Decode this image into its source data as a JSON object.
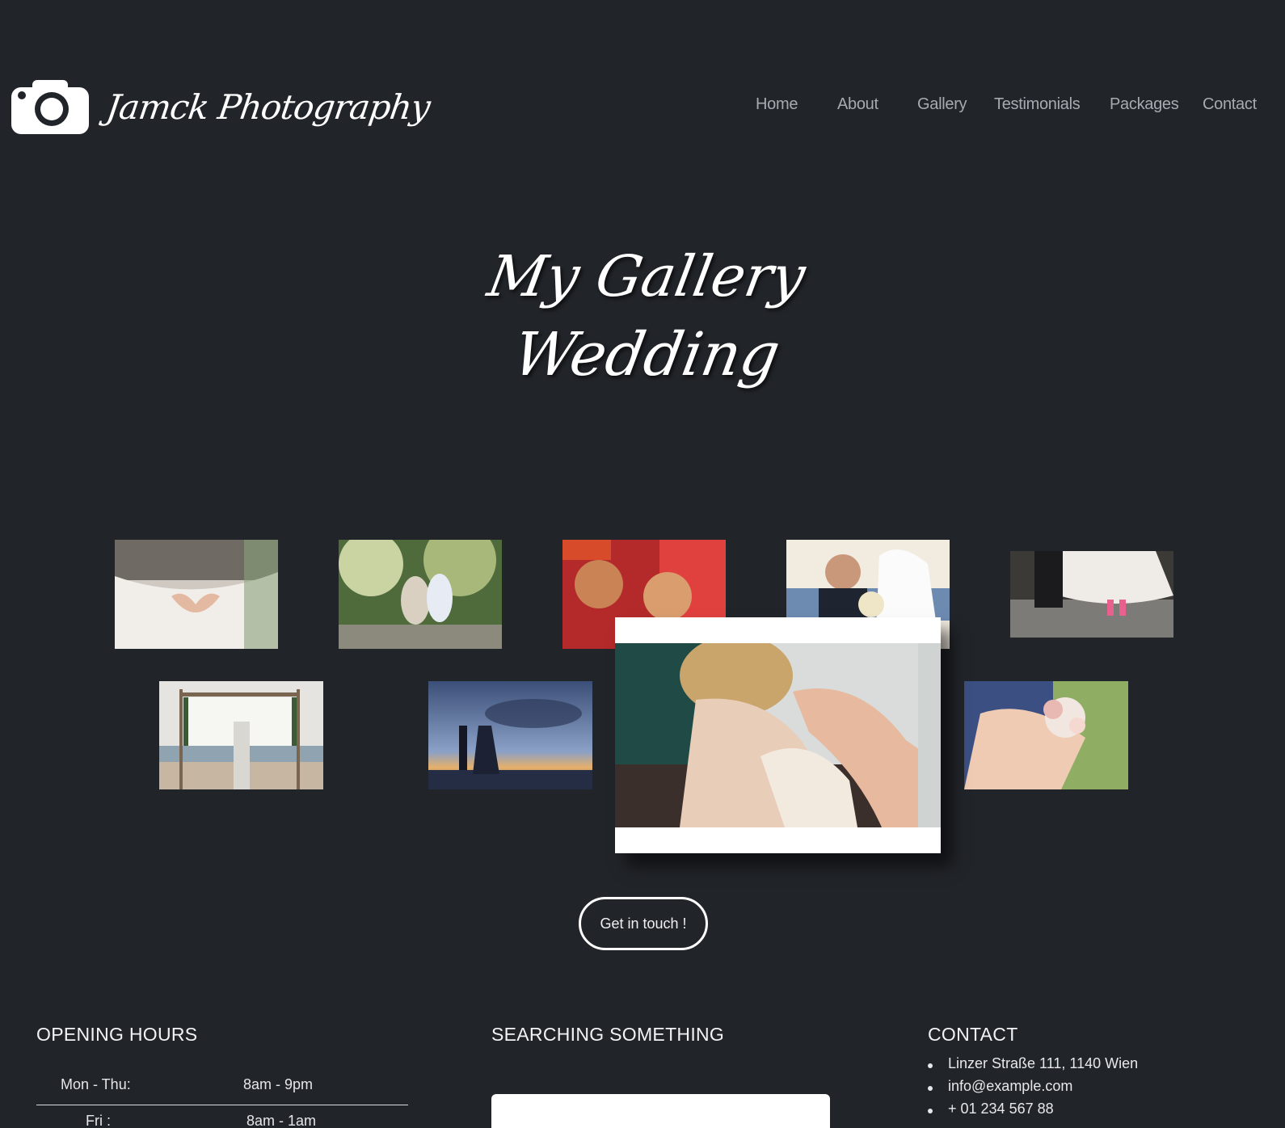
{
  "brand": {
    "name": "Jamck Photography",
    "logo_icon": "camera-icon"
  },
  "nav": [
    {
      "label": "Home"
    },
    {
      "label": "About"
    },
    {
      "label": "Gallery"
    },
    {
      "label": "Testimonials"
    },
    {
      "label": "Packages"
    },
    {
      "label": "Contact"
    }
  ],
  "hero": {
    "line1": "My Gallery",
    "line2": "Wedding"
  },
  "gallery": {
    "photos": [
      {
        "name": "photo-bride-heart-hands"
      },
      {
        "name": "photo-couple-forest"
      },
      {
        "name": "photo-indian-ceremony"
      },
      {
        "name": "photo-couple-bouquet"
      },
      {
        "name": "photo-bride-sneakers"
      },
      {
        "name": "photo-beach-altar"
      },
      {
        "name": "photo-sunset-silhouette"
      },
      {
        "name": "photo-hug-bouquet"
      }
    ],
    "modal_photo": "photo-bride-necklace"
  },
  "cta_label": "Get in touch !",
  "footer": {
    "hours_title": "OPENING HOURS",
    "hours": [
      {
        "day": "Mon - Thu:",
        "time": "8am - 9pm"
      },
      {
        "day": "Fri :",
        "time": "8am - 1am"
      }
    ],
    "search_title": "SEARCHING SOMETHING",
    "contact_title": "CONTACT",
    "contact": [
      "Linzer Straße 111, 1140 Wien",
      "info@example.com",
      "+ 01 234 567 88"
    ]
  },
  "colors": {
    "background": "#212429",
    "nav_text": "#a7abb1",
    "white": "#ffffff"
  }
}
